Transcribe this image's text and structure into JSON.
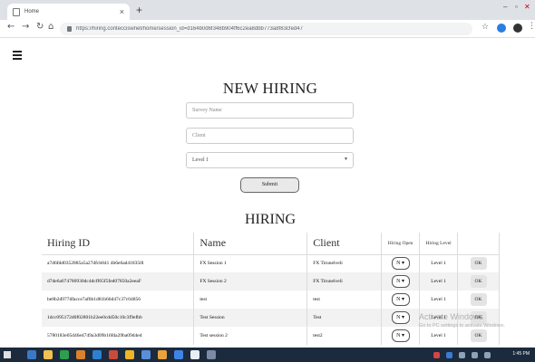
{
  "browser": {
    "tab_title": "Home",
    "tab_close": "×",
    "new_tab": "+",
    "url": "https://hiring.contecciswnet/home/session_id=d164b0d6f348b904ff6c2ea8dbb773a8f83cfed47"
  },
  "page": {
    "new_title": "NEW HIRING",
    "survey_placeholder": "Survey Name",
    "client_placeholder": "Client",
    "level_selected": "Level 1",
    "submit_label": "Submit",
    "hiring_title": "HIRING"
  },
  "table": {
    "headers": [
      "Hiring ID",
      "Name",
      "Client",
      "Hiring Open",
      "Hiring Level",
      ""
    ],
    "rows": [
      {
        "id": "a7d6fdd0352885a5a27dfcb841 4b6e6ad418350l",
        "name": "FX Session 1",
        "client": "FX Tirunelveli",
        "open": "N",
        "level": "Level 1",
        "action": "OK"
      },
      {
        "id": "d7de6a074780930dc4dcff05f5fed07850a2eeaF",
        "name": "FX Session 2",
        "client": "FX Tirunelveli",
        "open": "N",
        "level": "Level 1",
        "action": "OK"
      },
      {
        "id": "be8b2d977dfacce7af6b1d81b66d47c37c04856",
        "name": "test",
        "client": "test",
        "open": "N",
        "level": "Level 1",
        "action": "OK"
      },
      {
        "id": "1dcc095172d0f02801b22ee0cdd50c10c3f9efbb",
        "name": "Test Session",
        "client": "Test",
        "open": "N",
        "level": "Level 1",
        "action": "OK"
      },
      {
        "id": "5780183e05d46e4749a3d09b16fda29ba09d4ed",
        "name": "Test session 2",
        "client": "test2",
        "open": "N",
        "level": "Level 1",
        "action": "OK"
      }
    ]
  },
  "watermark": {
    "line1": "Activate Windows",
    "line2": "Go to PC settings to activate Windows."
  },
  "taskbar": {
    "clock": "1:45 PM"
  },
  "colors": {
    "taskbar": "#1b2a3d",
    "row_alt": "#f2f2f2"
  }
}
